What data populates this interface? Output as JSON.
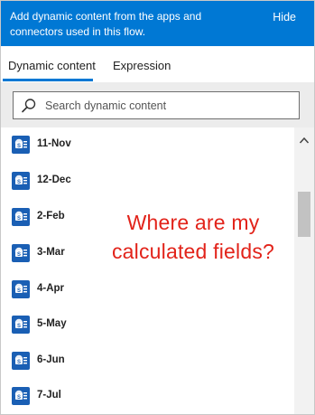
{
  "banner": {
    "text": "Add dynamic content from the apps and connectors used in this flow.",
    "hide_label": "Hide"
  },
  "tabs": [
    {
      "label": "Dynamic content",
      "selected": true
    },
    {
      "label": "Expression",
      "selected": false
    }
  ],
  "search": {
    "placeholder": "Search dynamic content"
  },
  "list": {
    "items": [
      {
        "label": "11-Nov",
        "icon": "sharepoint-list-icon"
      },
      {
        "label": "12-Dec",
        "icon": "sharepoint-list-icon"
      },
      {
        "label": "2-Feb",
        "icon": "sharepoint-list-icon"
      },
      {
        "label": "3-Mar",
        "icon": "sharepoint-list-icon"
      },
      {
        "label": "4-Apr",
        "icon": "sharepoint-list-icon"
      },
      {
        "label": "5-May",
        "icon": "sharepoint-list-icon"
      },
      {
        "label": "6-Jun",
        "icon": "sharepoint-list-icon"
      },
      {
        "label": "7-Jul",
        "icon": "sharepoint-list-icon"
      }
    ]
  },
  "annotation": {
    "line1": "Where are my",
    "line2": "calculated fields?"
  },
  "colors": {
    "accent": "#0078d4",
    "icon_bg": "#1a5fb4",
    "annotation": "#e2231a"
  }
}
